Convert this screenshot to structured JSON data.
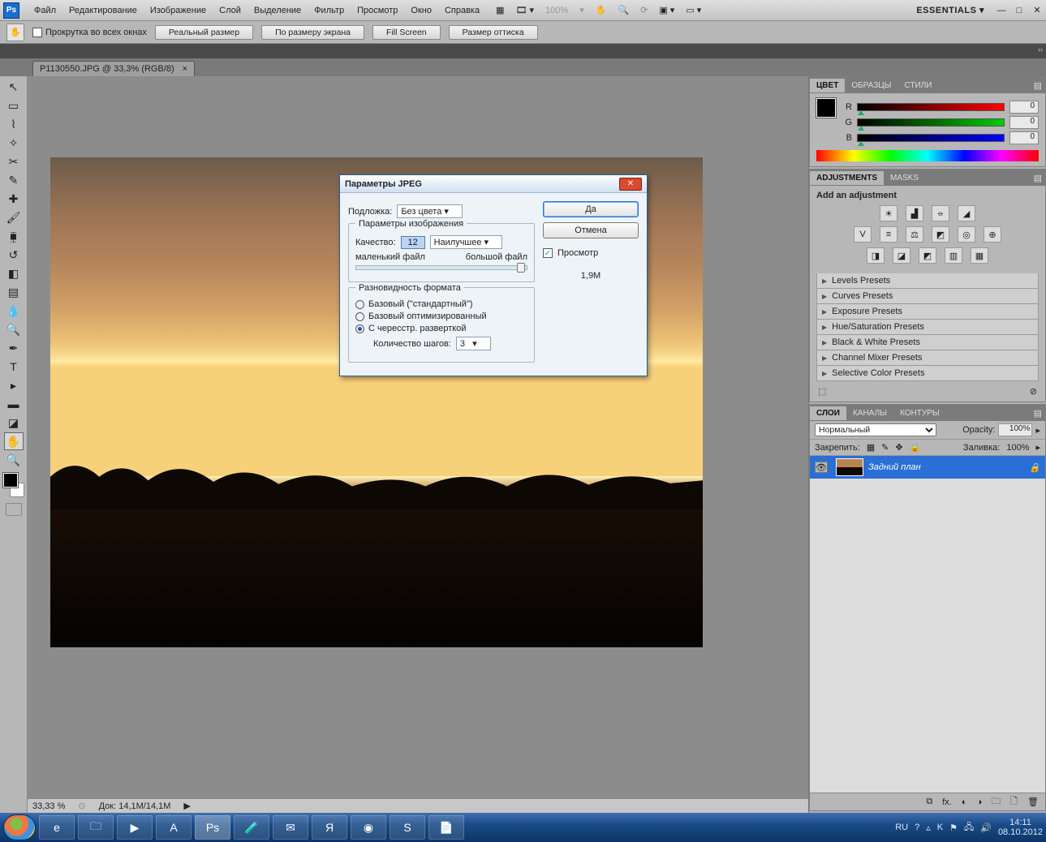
{
  "menu": {
    "items": [
      "Файл",
      "Редактирование",
      "Изображение",
      "Слой",
      "Выделение",
      "Фильтр",
      "Просмотр",
      "Окно",
      "Справка"
    ],
    "zoom": "100%",
    "workspace_label": "ESSENTIALS"
  },
  "options": {
    "scroll_all": "Прокрутка во всех окнах",
    "btns": [
      "Реальный размер",
      "По размеру экрана",
      "Fill Screen",
      "Размер оттиска"
    ]
  },
  "doc_tab": "P1130550.JPG @ 33,3% (RGB/8)",
  "status": {
    "zoom": "33,33 %",
    "doc": "Док: 14,1M/14,1M"
  },
  "color_panel": {
    "tabs": [
      "ЦВЕТ",
      "ОБРАЗЦЫ",
      "СТИЛИ"
    ],
    "channels": [
      {
        "l": "R",
        "v": "0"
      },
      {
        "l": "G",
        "v": "0"
      },
      {
        "l": "B",
        "v": "0"
      }
    ]
  },
  "adjust": {
    "tabs": [
      "ADJUSTMENTS",
      "MASKS"
    ],
    "hint": "Add an adjustment",
    "presets": [
      "Levels Presets",
      "Curves Presets",
      "Exposure Presets",
      "Hue/Saturation Presets",
      "Black & White Presets",
      "Channel Mixer Presets",
      "Selective Color Presets"
    ]
  },
  "layers": {
    "tabs": [
      "СЛОИ",
      "КАНАЛЫ",
      "КОНТУРЫ"
    ],
    "blend": "Нормальный",
    "opacity_label": "Opacity:",
    "opacity": "100%",
    "lock_label": "Закрепить:",
    "fill_label": "Заливка:",
    "fill": "100%",
    "item": "Задний план"
  },
  "dialog": {
    "title": "Параметры JPEG",
    "ok": "Да",
    "cancel": "Отмена",
    "matte_label": "Подложка:",
    "matte_value": "Без цвета",
    "group1": "Параметры изображения",
    "quality_label": "Качество:",
    "quality_value": "12",
    "quality_preset": "Наилучшее",
    "small": "маленький файл",
    "big": "большой файл",
    "group2": "Разновидность формата",
    "fmt": [
      "Базовый (\"стандартный\")",
      "Базовый оптимизированный",
      "С чересстр. разверткой"
    ],
    "steps_label": "Количество шагов:",
    "steps": "3",
    "preview": "Просмотр",
    "size": "1,9M"
  },
  "taskbar": {
    "lang": "RU",
    "time": "14:11",
    "date": "08.10.2012"
  }
}
